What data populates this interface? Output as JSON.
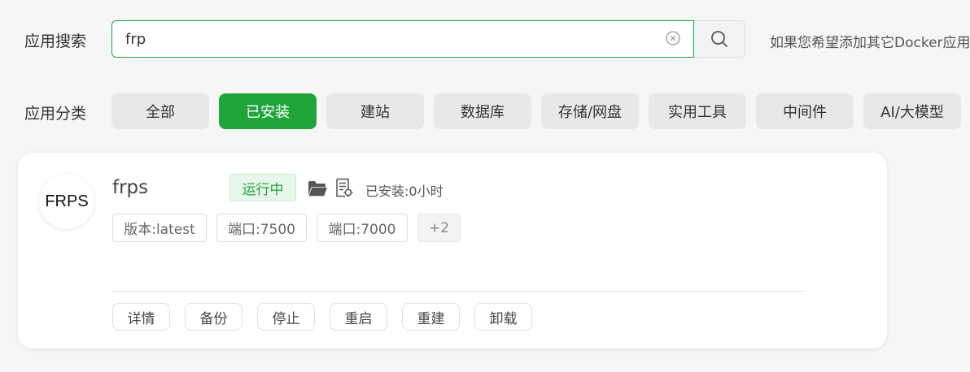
{
  "search": {
    "label": "应用搜索",
    "value": "frp",
    "hint": "如果您希望添加其它Docker应用"
  },
  "categories": {
    "label": "应用分类",
    "items": [
      {
        "label": "全部",
        "active": false
      },
      {
        "label": "已安装",
        "active": true
      },
      {
        "label": "建站",
        "active": false
      },
      {
        "label": "数据库",
        "active": false
      },
      {
        "label": "存储/网盘",
        "active": false
      },
      {
        "label": "实用工具",
        "active": false
      },
      {
        "label": "中间件",
        "active": false
      },
      {
        "label": "AI/大模型",
        "active": false
      }
    ]
  },
  "app": {
    "logo_text": "FRPS",
    "name": "frps",
    "status": "运行中",
    "installed": "已安装:0小时",
    "tags": [
      "版本:latest",
      "端口:7500",
      "端口:7000",
      "+2"
    ],
    "actions": [
      "详情",
      "备份",
      "停止",
      "重启",
      "重建",
      "卸载"
    ],
    "icons": [
      "folder-icon",
      "log-icon"
    ]
  },
  "colors": {
    "accent": "#20a53a",
    "status_bg": "#e8f6ec"
  }
}
